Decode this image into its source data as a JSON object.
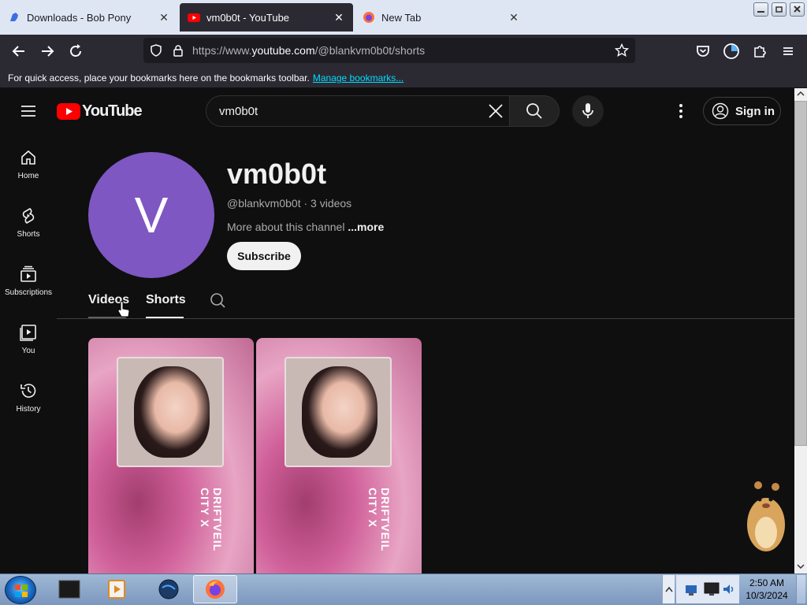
{
  "browser": {
    "tabs": [
      {
        "title": "Downloads - Bob Pony",
        "active": false
      },
      {
        "title": "vm0b0t - YouTube",
        "active": true
      },
      {
        "title": "New Tab",
        "active": false
      }
    ],
    "tab_close_glyph": "✕",
    "url_prefix": "https://www.",
    "url_domain": "youtube.com",
    "url_path": "/@blankvm0b0t/shorts",
    "bookmarks_message": "For quick access, place your bookmarks here on the bookmarks toolbar.",
    "bookmarks_link": "Manage bookmarks..."
  },
  "youtube": {
    "logo_text": "YouTube",
    "search_value": "vm0b0t",
    "sign_in_label": "Sign in",
    "sidebar": [
      {
        "label": "Home",
        "icon": "home-icon"
      },
      {
        "label": "Shorts",
        "icon": "shorts-icon"
      },
      {
        "label": "Subscriptions",
        "icon": "subscriptions-icon"
      },
      {
        "label": "You",
        "icon": "you-icon"
      },
      {
        "label": "History",
        "icon": "history-icon"
      }
    ],
    "channel": {
      "avatar_letter": "V",
      "avatar_color": "#7e57c2",
      "name": "vm0b0t",
      "meta": "@blankvm0b0t · 3 videos",
      "about": "More about this channel",
      "about_more": "...more",
      "subscribe_label": "Subscribe"
    },
    "channel_tabs": [
      {
        "label": "Videos",
        "selected": false
      },
      {
        "label": "Shorts",
        "selected": true
      }
    ],
    "shorts": [
      {
        "title_overlay": "DRIFTVEIL CITY X"
      },
      {
        "title_overlay": "DRIFTVEIL CITY X"
      }
    ]
  },
  "taskbar": {
    "time": "2:50 AM",
    "date": "10/3/2024"
  },
  "colors": {
    "youtube_red": "#ff0000",
    "page_bg": "#0f0f0f",
    "tab_active_bg": "#2b2a33",
    "link_color": "#00ddff"
  }
}
